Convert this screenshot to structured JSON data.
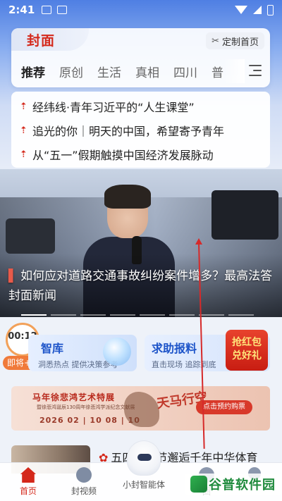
{
  "status_bar": {
    "time": "2:41",
    "battery": ""
  },
  "header": {
    "brand": "封面",
    "customize_label": "定制首页",
    "tabs": [
      "推荐",
      "原创",
      "生活",
      "真相",
      "四川",
      "普"
    ]
  },
  "headlines": [
    "经纬线·青年习近平的“人生课堂”",
    "追光的你｜明天的中国，希望寄予青年",
    "从“五一”假期触摸中国经济发展脉动"
  ],
  "hero": {
    "title": "如何应对道路交通事故纠纷案件增多？最高法答封面新闻"
  },
  "timer": {
    "time": "00:12",
    "tag": "即将+5"
  },
  "services": [
    {
      "title": "智库",
      "subtitle": "洞悉热点 提供决策参考"
    },
    {
      "title": "求助报料",
      "subtitle": "直击现场 追踪到底"
    }
  ],
  "red_packet": {
    "line1": "抢红包",
    "line2": "兑好礼"
  },
  "banner": {
    "title": "马年徐悲鸿艺术特展",
    "subtitle": "暨徐悲鸿诞辰130周年徐悲鸿学派纪念文献展",
    "date": "2026 02 | 10 08 | 10",
    "calligraphy": "天马行空",
    "button": "点击预约购票"
  },
  "news": {
    "title": "五四青年节邂逅千年中华体育"
  },
  "bottom_nav": [
    {
      "label": "首页"
    },
    {
      "label": "封视频"
    },
    {
      "label": "小封智能体"
    },
    {
      "label": "圈"
    },
    {
      "label": ""
    }
  ],
  "watermark": "谷普软件园",
  "colors": {
    "brand_red": "#d4281b",
    "accent_blue": "#1d54c9",
    "annotation_red": "#d62a2a"
  }
}
